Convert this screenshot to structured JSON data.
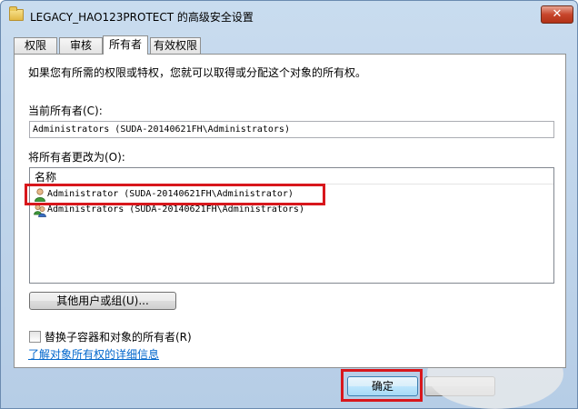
{
  "window": {
    "title": "LEGACY_HAO123PROTECT 的高级安全设置",
    "close_glyph": "✕"
  },
  "tabs": [
    {
      "label": "权限"
    },
    {
      "label": "审核"
    },
    {
      "label": "所有者"
    },
    {
      "label": "有效权限"
    }
  ],
  "owner_tab": {
    "intro": "如果您有所需的权限或特权，您就可以取得或分配这个对象的所有权。",
    "current_owner_label": "当前所有者(C):",
    "current_owner_value": "Administrators (SUDA-20140621FH\\Administrators)",
    "change_owner_label": "将所有者更改为(O):",
    "list_header": "名称",
    "owners": [
      {
        "name": "Administrator (SUDA-20140621FH\\Administrator)",
        "icon": "single-user-icon",
        "selected": true
      },
      {
        "name": "Administrators (SUDA-20140621FH\\Administrators)",
        "icon": "user-group-icon",
        "selected": false
      }
    ],
    "other_users_button": "其他用户或组(U)...",
    "replace_checkbox_label": "替换子容器和对象的所有者(R)",
    "replace_checked": false,
    "learn_more_link": "了解对象所有权的详细信息"
  },
  "footer": {
    "ok_button": "确定"
  },
  "colors": {
    "highlight": "#d8171c",
    "link": "#0066cc",
    "titlebar": "#c9dcef"
  }
}
